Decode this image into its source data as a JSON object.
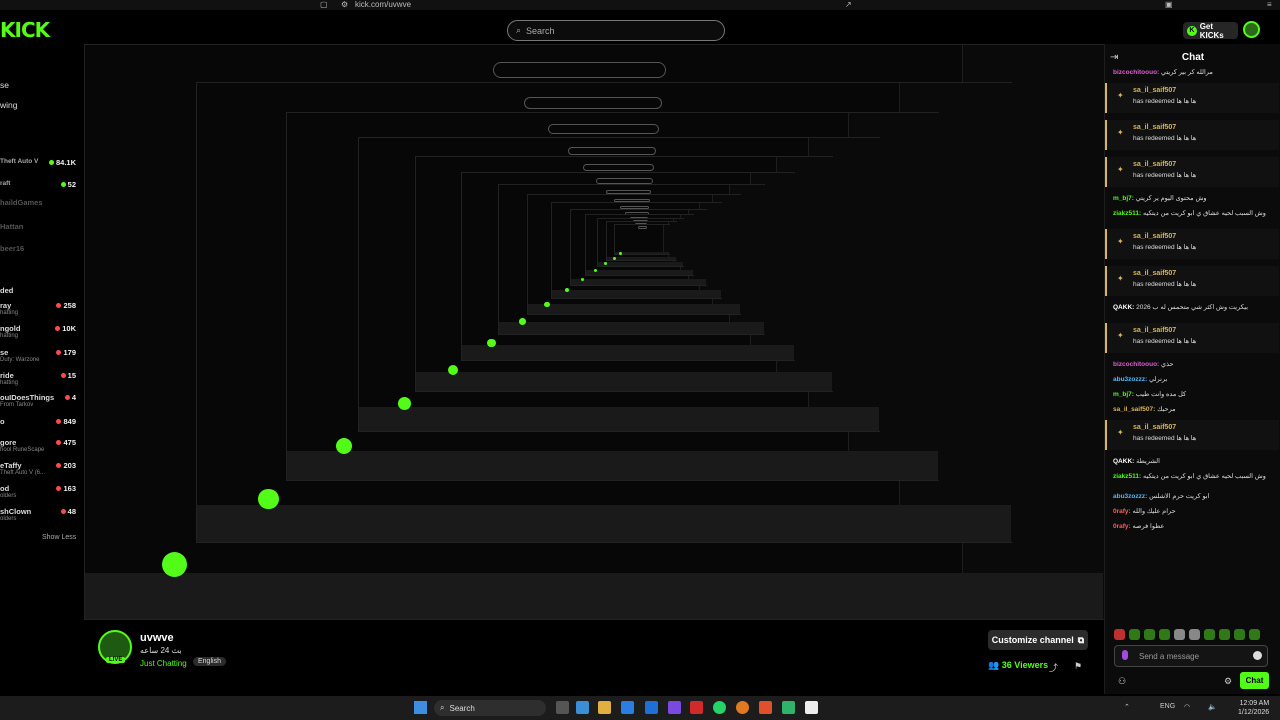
{
  "browser": {
    "url": "kick.com/uvwve"
  },
  "header": {
    "logo": "KICK",
    "search_placeholder": "Search",
    "get_kicks_label": "Get KICKs"
  },
  "sidebar": {
    "nav": [
      "se",
      "wing"
    ],
    "channels": [
      {
        "name": "Theft Auto V",
        "count": "84.1K"
      },
      {
        "name": "raft",
        "count": "52"
      },
      {
        "name": "haildGames",
        "count": ""
      },
      {
        "name": "Hattan",
        "count": ""
      },
      {
        "name": "beer16",
        "count": ""
      }
    ],
    "section_label": "ded",
    "following": [
      {
        "name": "ray",
        "sub": "hatting",
        "count": "258"
      },
      {
        "name": "ngold",
        "sub": "hatting",
        "count": "10K"
      },
      {
        "name": "se",
        "sub": "Duty: Warzone",
        "count": "179"
      },
      {
        "name": "ride",
        "sub": "hatting",
        "count": "15"
      },
      {
        "name": "ouIDoesThings",
        "sub": "From Tarkov",
        "count": "4"
      },
      {
        "name": "o",
        "sub": "",
        "count": "849"
      },
      {
        "name": "gore",
        "sub": "hool RuneScape",
        "count": "475"
      },
      {
        "name": "eTaffy",
        "sub": "Theft Auto V (6...",
        "count": "203"
      },
      {
        "name": "od",
        "sub": "olders",
        "count": "163"
      },
      {
        "name": "shClown",
        "sub": "olders",
        "count": "48"
      }
    ],
    "show_less": "Show Less"
  },
  "channel": {
    "name": "uvwve",
    "subtitle": "بث 24 ساعه",
    "category": "Just Chatting",
    "language": "English",
    "live": "LIVE",
    "customize_label": "Customize channel",
    "viewers_count": "36",
    "viewers_label": "Viewers"
  },
  "chat": {
    "title": "Chat",
    "messages": [
      {
        "type": "text",
        "user": "bizcochitoouo:",
        "text": "مرالله كر بير كريتي",
        "color": "#e05bd6"
      },
      {
        "type": "redeem",
        "user": "sa_il_saif507",
        "text": "has redeemed ها ها ها"
      },
      {
        "type": "redeem",
        "user": "sa_il_saif507",
        "text": "has redeemed ها ها ها"
      },
      {
        "type": "redeem",
        "user": "sa_il_saif507",
        "text": "has redeemed ها ها ها"
      },
      {
        "type": "text",
        "user": "m_bj7:",
        "text": "وش محتوى اليوم ير كريتي",
        "color": "#53fc18"
      },
      {
        "type": "text",
        "user": "ziakz511:",
        "text": "وش السبب لحيه عشاق ي ابو كريت من ديتكيه",
        "color": "#53fc18"
      },
      {
        "type": "redeem",
        "user": "sa_il_saif507",
        "text": "has redeemed ها ها ها"
      },
      {
        "type": "redeem",
        "user": "sa_il_saif507",
        "text": "has redeemed ها ها ها"
      },
      {
        "type": "text",
        "user": "QAKK:",
        "text": "2026 بيكريت وش اكثر شي متحمس له ب",
        "color": "#ffffff"
      },
      {
        "type": "redeem",
        "user": "sa_il_saif507",
        "text": "has redeemed ها ها ها"
      },
      {
        "type": "text",
        "user": "bizcochitoouo:",
        "text": "حذي",
        "color": "#e05bd6"
      },
      {
        "type": "text",
        "user": "abu3zozzz:",
        "text": "برنرلي",
        "color": "#53b8fc"
      },
      {
        "type": "text",
        "user": "m_bj7:",
        "text": "كل مده وانت طيب",
        "color": "#53fc18"
      },
      {
        "type": "text",
        "user": "sa_il_saif507:",
        "text": "مرحبك",
        "color": "#d9b45a"
      },
      {
        "type": "redeem",
        "user": "sa_il_saif507",
        "text": "has redeemed ها ها ها"
      },
      {
        "type": "text",
        "user": "QAKK:",
        "text": "الشريطة",
        "color": "#ffffff"
      },
      {
        "type": "text",
        "user": "ziakz511:",
        "text": "وش السبب لحيه عشاق ي ابو كريت من ديتكيه",
        "color": "#53fc18"
      },
      {
        "type": "text",
        "user": "abu3zozzz:",
        "text": "ابو كريت حرم الاشلس",
        "color": "#53b8fc"
      },
      {
        "type": "text",
        "user": "0rafy:",
        "text": "حرام عليك والله",
        "color": "#ff5a5a"
      },
      {
        "type": "text",
        "user": "0rafy:",
        "text": "عطوا فرصه",
        "color": "#ff5a5a"
      }
    ],
    "send_placeholder": "Send a message",
    "chat_button": "Chat"
  },
  "taskbar": {
    "search_label": "Search",
    "lang": "ENG",
    "time": "12:09 AM",
    "date": "1/12/2026"
  },
  "colors": {
    "accent": "#53fc18",
    "redeem": "#d9b45a",
    "background": "#000000"
  }
}
